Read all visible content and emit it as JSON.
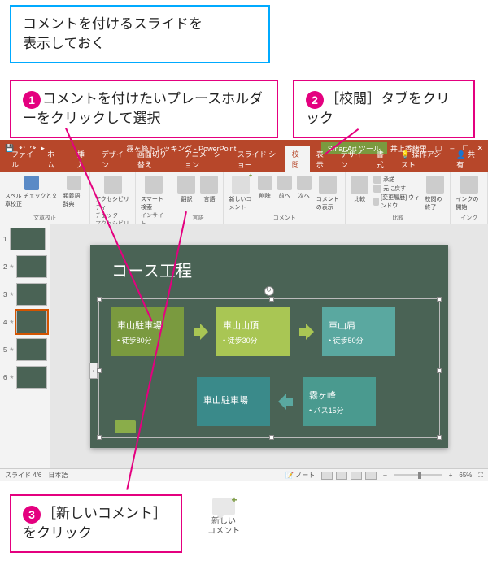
{
  "callouts": {
    "intro": "コメントを付けるスライドを\n表示しておく",
    "step1": "コメントを付けたいプレースホルダーをクリックして選択",
    "step2": "［校閲］タブをクリック",
    "step3": "［新しいコメント］をクリック"
  },
  "stepNums": {
    "s1": "1",
    "s2": "2",
    "s3": "3"
  },
  "titlebar": {
    "docTitle": "霧ヶ峰トレッキング - PowerPoint",
    "toolContext": "SmartArt ツール",
    "userName": "井上香緒里"
  },
  "tabs": {
    "file": "ファイル",
    "home": "ホーム",
    "insert": "挿入",
    "design": "デザイン",
    "transitions": "画面切り替え",
    "animations": "アニメーション",
    "slideshow": "スライド ショー",
    "review": "校閲",
    "view": "表示",
    "saDesign": "デザイン",
    "saFormat": "書式",
    "tell": "操作アシスト",
    "share": "共有"
  },
  "ribbon": {
    "g1": {
      "label": "文章校正",
      "b1": "スペル チェックと文章校正",
      "b2": "類義語辞典"
    },
    "g2": {
      "label": "アクセシビリティ",
      "b1": "アクセシビリティ\nチェック"
    },
    "g3": {
      "label": "インサイト",
      "b1": "スマート検索"
    },
    "g4": {
      "label": "言語",
      "b1": "翻訳",
      "b2": "言語"
    },
    "g5": {
      "label": "コメント",
      "b1": "新しいコメント",
      "b2": "削除",
      "b3": "前へ",
      "b4": "次へ",
      "b5": "コメントの表示"
    },
    "g6": {
      "label": "比較",
      "b1": "比較",
      "b2": "承諾",
      "b3": "元に戻す",
      "b4": "[変更履歴] ウィンドウ",
      "b5": "校閲の終了"
    },
    "g7": {
      "label": "インク",
      "b1": "インクの開始"
    }
  },
  "slide": {
    "title": "コース工程",
    "boxes": {
      "b1t": "車山駐車場",
      "b1s": "徒歩80分",
      "b2t": "車山山頂",
      "b2s": "徒歩30分",
      "b3t": "車山肩",
      "b3s": "徒歩50分",
      "b4t": "車山駐車場",
      "b5t": "霧ヶ峰",
      "b5s": "バス15分"
    }
  },
  "thumbs": [
    "1",
    "2",
    "3",
    "4",
    "5",
    "6"
  ],
  "status": {
    "slideInfo": "スライド 4/6",
    "lang": "日本語",
    "notes": "ノート",
    "zoom": "65%"
  },
  "bottomIcon": {
    "label": "新しい\nコメント"
  }
}
